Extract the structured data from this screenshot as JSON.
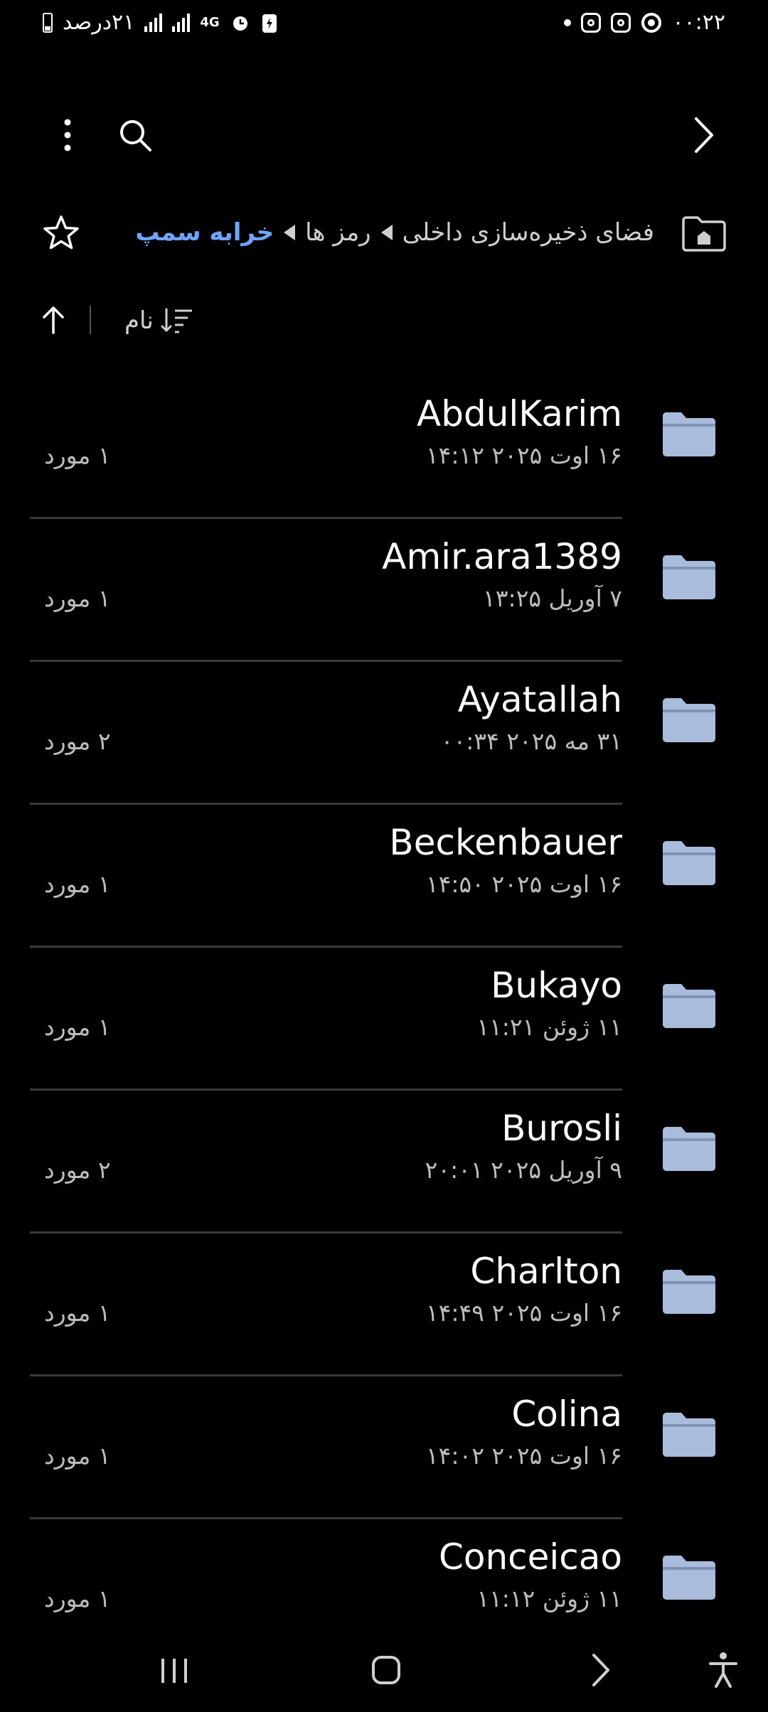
{
  "status_bar": {
    "time": "۰۰:۲۲",
    "battery_text": "۲۱درصد",
    "network": "4G"
  },
  "breadcrumb": {
    "items": [
      "فضای ذخیره‌سازی داخلی",
      "رمز ها",
      "خرابه سمپ"
    ]
  },
  "sort": {
    "label": "نام"
  },
  "folders": [
    {
      "name": "AbdulKarim",
      "date": "۱۶ اوت ۲۰۲۵ ۱۴:۱۲",
      "count": "۱ مورد"
    },
    {
      "name": "Amir.ara1389",
      "date": "۷ آوریل ۱۳:۲۵",
      "count": "۱ مورد"
    },
    {
      "name": "Ayatallah",
      "date": "۳۱ مه ۲۰۲۵ ۰۰:۳۴",
      "count": "۲ مورد"
    },
    {
      "name": "Beckenbauer",
      "date": "۱۶ اوت ۲۰۲۵ ۱۴:۵۰",
      "count": "۱ مورد"
    },
    {
      "name": "Bukayo",
      "date": "۱۱ ژوئن ۱۱:۲۱",
      "count": "۱ مورد"
    },
    {
      "name": "Burosli",
      "date": "۹ آوریل ۲۰۲۵ ۲۰:۰۱",
      "count": "۲ مورد"
    },
    {
      "name": "Charlton",
      "date": "۱۶ اوت ۲۰۲۵ ۱۴:۴۹",
      "count": "۱ مورد"
    },
    {
      "name": "Colina",
      "date": "۱۶ اوت ۲۰۲۵ ۱۴:۰۲",
      "count": "۱ مورد"
    },
    {
      "name": "Conceicao",
      "date": "۱۱ ژوئن ۱۱:۱۲",
      "count": "۱ مورد"
    }
  ],
  "colors": {
    "background": "#000000",
    "accent": "#6ea6ff",
    "folder": "#a9bcdc",
    "secondary_text": "#bdbdbd"
  }
}
